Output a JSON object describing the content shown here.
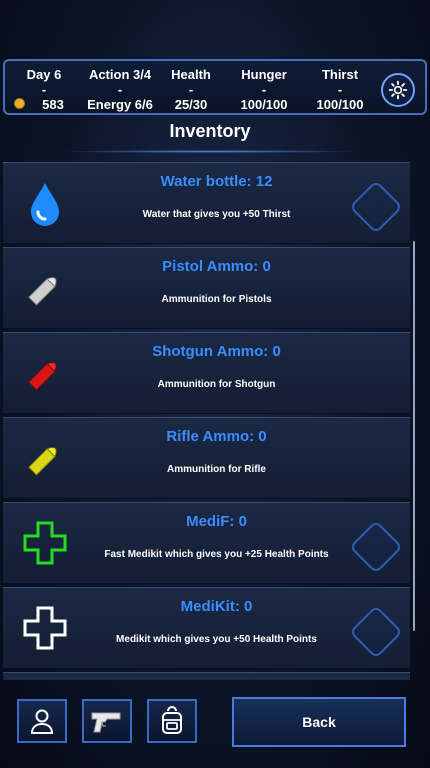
{
  "stats": {
    "day": {
      "label": "Day 6",
      "sep": "-",
      "value": "583"
    },
    "action": {
      "label": "Action 3/4",
      "sep": "-",
      "value": "Energy 6/6"
    },
    "health": {
      "label": "Health",
      "sep": "-",
      "value": "25/30"
    },
    "hunger": {
      "label": "Hunger",
      "sep": "-",
      "value": "100/100"
    },
    "thirst": {
      "label": "Thirst",
      "sep": "-",
      "value": "100/100"
    }
  },
  "title": "Inventory",
  "items": [
    {
      "name": "Water bottle: 12",
      "desc": "Water that gives you +50 Thirst",
      "icon": "water-drop-icon",
      "color": "#1e8cff",
      "usable": true
    },
    {
      "name": "Pistol Ammo: 0",
      "desc": "Ammunition for Pistols",
      "icon": "bullet-icon",
      "color": "#d0d0d0",
      "usable": false
    },
    {
      "name": "Shotgun Ammo: 0",
      "desc": "Ammunition for Shotgun",
      "icon": "bullet-icon",
      "color": "#e01818",
      "usable": false
    },
    {
      "name": "Rifle Ammo: 0",
      "desc": "Ammunition for Rifle",
      "icon": "bullet-icon",
      "color": "#e0e018",
      "usable": false
    },
    {
      "name": "MediF: 0",
      "desc": "Fast Medikit which gives you +25 Health Points",
      "icon": "medical-cross-icon",
      "color": "#22dd22",
      "usable": true
    },
    {
      "name": "MediKit: 0",
      "desc": "Medikit which gives you +50 Health Points",
      "icon": "medical-cross-icon",
      "color": "#ffffff",
      "usable": true
    }
  ],
  "nav": {
    "profile": "person-icon",
    "weapons": "pistol-icon",
    "backpack": "backpack-icon",
    "back_label": "Back"
  }
}
